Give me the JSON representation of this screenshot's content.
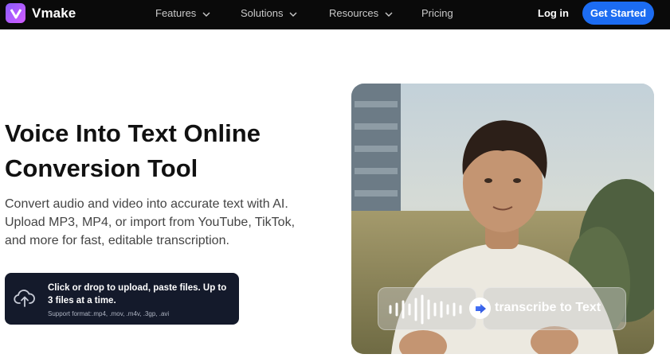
{
  "nav": {
    "logo_text": "Vmake",
    "items": [
      {
        "label": "Features"
      },
      {
        "label": "Solutions"
      },
      {
        "label": "Resources"
      },
      {
        "label": "Pricing"
      }
    ],
    "login_label": "Log in",
    "cta_label": "Get Started"
  },
  "hero": {
    "title_line1": "Voice Into Text Online",
    "title_line2": "Conversion Tool",
    "subtitle": "Convert audio and video into accurate text with AI. Upload MP3, MP4, or import from YouTube, TikTok, and more for fast, editable transcription."
  },
  "upload": {
    "main_text": "Click or drop to upload, paste files. Up to 3 files at a time.",
    "formats_text": "Support format:.mp4, .mov, .m4v, .3gp, .avi"
  },
  "overlay": {
    "transcribe_label": "transcribe to Text"
  },
  "colors": {
    "nav_bg": "#0a0a0a",
    "cta_bg": "#1c6cf2",
    "upload_bg": "#141a2b",
    "logo_gradient_start": "#8a5cff",
    "logo_gradient_end": "#d35cff"
  }
}
